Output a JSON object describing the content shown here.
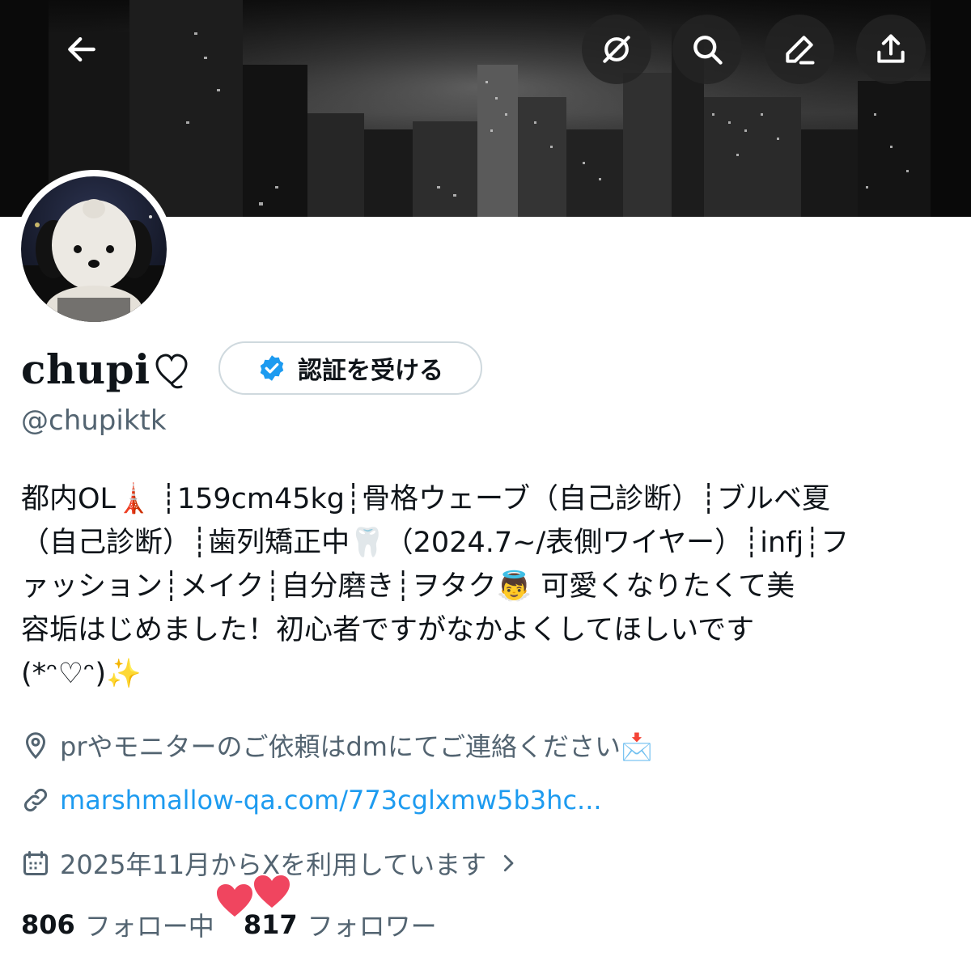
{
  "profile": {
    "display_name": "chupi",
    "handle": "@chupiktk",
    "verify_label": "認証を受ける",
    "bio_lines": [
      "都内OL🗼 ┊159cm45kg┊骨格ウェーブ（自己診断）┊ブルベ夏",
      "（自己診断）┊歯列矯正中🦷（2024.7~/表側ワイヤー）┊infj┊フ",
      "ァッション┊メイク┊自分磨き┊ヲタク👼 可愛くなりたくて美",
      "容垢はじめました！初心者ですがなかよくしてほしいです",
      "(*ᵔ♡ᵔ)✨"
    ],
    "location": "prやモニターのご依頼はdmにてご連絡ください📩",
    "link": "marshmallow-qa.com/773cglxmw5b3hc...",
    "joined": "2025年11月からXを利用しています",
    "following_count": "806",
    "following_label": "フォロー中",
    "followers_count": "817",
    "followers_label": "フォロワー"
  },
  "colors": {
    "accent": "#1d9bf0",
    "secondary_text": "#536471",
    "primary_text": "#0f1419",
    "heart": "#f0455f"
  },
  "icons": [
    "back-arrow-icon",
    "grok-icon",
    "search-icon",
    "edit-icon",
    "share-icon",
    "verified-badge-icon",
    "location-icon",
    "link-icon",
    "calendar-icon",
    "chevron-right-icon",
    "hearts-sticker"
  ]
}
